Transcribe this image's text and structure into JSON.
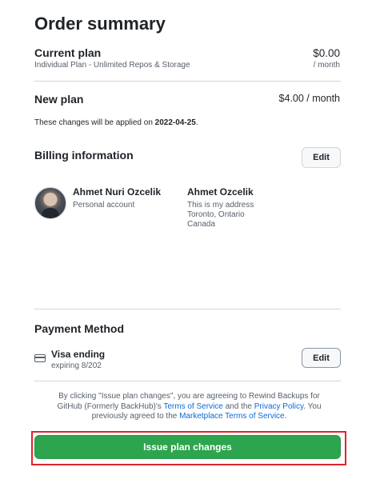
{
  "title": "Order summary",
  "current_plan": {
    "label": "Current plan",
    "description": "Individual Plan - Unlimited Repos & Storage",
    "price": "$0.00",
    "period": "/ month"
  },
  "new_plan": {
    "label": "New plan",
    "price": "$4.00 / month"
  },
  "applied_note": {
    "prefix": "These changes will be applied on ",
    "date": "2022-04-25",
    "suffix": "."
  },
  "billing": {
    "label": "Billing information",
    "edit_label": "Edit",
    "account_name": "Ahmet Nuri Ozcelik",
    "account_type": "Personal account",
    "address_name": "Ahmet Ozcelik",
    "address_line1": "This is my address",
    "address_line2": "Toronto, Ontario",
    "address_line3": "Canada"
  },
  "payment": {
    "label": "Payment Method",
    "card_label": "Visa ending",
    "expiry": "expiring 8/202",
    "edit_label": "Edit"
  },
  "terms": {
    "line1": "By clicking \"Issue plan changes\", you are agreeing to Rewind Backups for",
    "line2_prefix": "GitHub (Formerly BackHub)'s ",
    "tos_link": "Terms of Service",
    "line2_mid": " and the ",
    "privacy_link": "Privacy Policy",
    "line2_suffix": ". You",
    "line3_prefix": "previously agreed to the ",
    "marketplace_link": "Marketplace Terms of Service",
    "line3_suffix": "."
  },
  "submit_label": "Issue plan changes",
  "colors": {
    "primary_button": "#2da44e",
    "link": "#0969da",
    "highlight_border": "#e0262a"
  },
  "icons": {
    "payment": "credit-card-icon",
    "avatar": "user-avatar"
  }
}
